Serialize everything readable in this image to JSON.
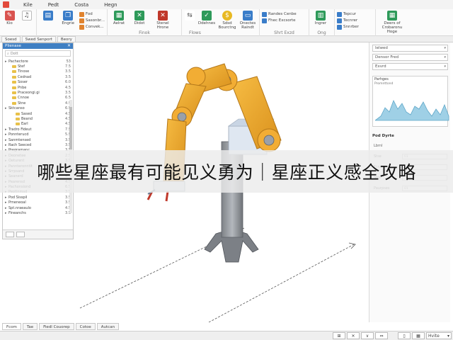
{
  "menu": {
    "items": [
      "Kile",
      "Pedt",
      "Costa",
      "Hegn"
    ]
  },
  "ribbon": {
    "groups": [
      {
        "label": "",
        "buttons": [
          {
            "label": "Kio",
            "icon": "pencil-icon",
            "color": "#d9534f"
          },
          {
            "label": "",
            "icon": "bell-icon",
            "color": "#555555"
          }
        ]
      },
      {
        "label": "",
        "buttons": [
          {
            "label": "",
            "icon": "document-icon",
            "color": "#3a7dc9"
          },
          {
            "label": "Engrie",
            "icon": "copy-icon",
            "color": "#3a7dc9"
          }
        ],
        "small": [
          {
            "label": "Fod",
            "color": "#e0832f"
          },
          {
            "label": "Sasonbr...",
            "color": "#e0832f"
          },
          {
            "label": "Convek...",
            "color": "#e0832f"
          }
        ]
      },
      {
        "label": "Finok",
        "buttons": [
          {
            "label": "Aelrat",
            "icon": "grid-icon",
            "color": "#2e9a5a"
          },
          {
            "label": "Didot",
            "icon": "cross-icon",
            "color": "#2e9a5a"
          },
          {
            "label": "Stenel\nHrone",
            "icon": "delete-icon",
            "color": "#c0392b"
          }
        ]
      },
      {
        "label": "Flows",
        "buttons": [
          {
            "label": "",
            "icon": "arrows-icon",
            "color": "#555555"
          },
          {
            "label": "Ddehnes",
            "icon": "check-icon",
            "color": "#2e9a5a"
          },
          {
            "label": "Sdsd\nBourctng",
            "icon": "coin-icon",
            "color": "#e8b923"
          },
          {
            "label": "Onectes\nRaindt",
            "icon": "folder-icon",
            "color": "#3a7dc9"
          }
        ]
      },
      {
        "label": "Shrt Exzd",
        "small": [
          {
            "label": "Randes Cenbe",
            "color": "#3a7dc9"
          },
          {
            "label": "Fhec Excsorte",
            "color": "#3a7dc9"
          },
          {
            "label": "Shrt Exzd",
            "color": "#3a7dc9"
          }
        ]
      },
      {
        "label": "Ong",
        "buttons": [
          {
            "label": "Ingrer",
            "icon": "chart-icon",
            "color": "#2e9a5a"
          }
        ]
      },
      {
        "label": "",
        "small": [
          {
            "label": "Tepcur",
            "color": "#3a7dc9"
          },
          {
            "label": "Tecnrer",
            "color": "#3a7dc9"
          },
          {
            "label": "Snnrber",
            "color": "#3a7dc9"
          }
        ]
      },
      {
        "label": "",
        "buttons": [
          {
            "label": "Deers of\nCrobaronu\nHoge",
            "icon": "spreadsheet-icon",
            "color": "#2e9a5a"
          }
        ]
      }
    ]
  },
  "doc_tabs": [
    "Soesd",
    "Swed Senport",
    "Beory"
  ],
  "left_panel": {
    "title": "Plienase",
    "search_placeholder": "Dott",
    "tree": [
      {
        "name": "Pachectore",
        "val": "53",
        "indent": 0,
        "folder": false
      },
      {
        "name": "Stef",
        "val": "7.5",
        "indent": 1,
        "folder": true
      },
      {
        "name": "Tinose",
        "val": "3.5",
        "indent": 1,
        "folder": true
      },
      {
        "name": "Cednad",
        "val": "3.5",
        "indent": 1,
        "folder": true
      },
      {
        "name": "Soser",
        "val": "6.0",
        "indent": 1,
        "folder": true
      },
      {
        "name": "Pnbe",
        "val": "4.5",
        "indent": 1,
        "folder": true
      },
      {
        "name": "Praceongi.gi",
        "val": "3.5",
        "indent": 1,
        "folder": true
      },
      {
        "name": "Cnnoe",
        "val": "6.5",
        "indent": 1,
        "folder": true
      },
      {
        "name": "Stne",
        "val": "4.9",
        "indent": 1,
        "folder": true
      },
      {
        "name": "Sktcanso",
        "val": "6.5",
        "indent": 0,
        "folder": false
      },
      {
        "name": "Sased",
        "val": "4.5",
        "indent": 2,
        "folder": true
      },
      {
        "name": "Beand",
        "val": "4.5",
        "indent": 2,
        "folder": true
      },
      {
        "name": "Earl",
        "val": "4.5",
        "indent": 2,
        "folder": true
      },
      {
        "name": "Tradro Fideut",
        "val": "7.5",
        "indent": 0,
        "folder": false
      },
      {
        "name": "Ponnterucd",
        "val": "5.9",
        "indent": 0,
        "folder": false
      },
      {
        "name": "Sanmtensed",
        "val": "3.5",
        "indent": 0,
        "folder": false
      },
      {
        "name": "Rach Seeced",
        "val": "3.5",
        "indent": 0,
        "folder": false
      },
      {
        "name": "Pregramanc",
        "val": "3.5",
        "indent": 0,
        "folder": false
      },
      {
        "name": "Deonetee",
        "val": "2.5",
        "indent": 0,
        "folder": false
      },
      {
        "name": "Oeturent",
        "val": "3.5",
        "indent": 0,
        "folder": false
      },
      {
        "name": "Pannteronntit",
        "val": "4.5",
        "indent": 0,
        "folder": false
      },
      {
        "name": "Srrpsand",
        "val": "3.5",
        "indent": 0,
        "folder": false
      },
      {
        "name": "Seanerd",
        "val": "4.5",
        "indent": 0,
        "folder": false
      },
      {
        "name": "Pearensd",
        "val": "4.5",
        "indent": 0,
        "folder": false
      },
      {
        "name": "Pachonsiond",
        "val": "6.5",
        "indent": 0,
        "folder": false
      },
      {
        "name": "Peoltnmsd",
        "val": "3.5",
        "indent": 0,
        "folder": false
      },
      {
        "name": "Pod Sisspil",
        "val": "3.5",
        "indent": 0,
        "folder": false
      },
      {
        "name": "Pmeneoal",
        "val": "3.5",
        "indent": 0,
        "folder": false
      },
      {
        "name": "Spt.nraeaulo",
        "val": "4.5",
        "indent": 0,
        "folder": false
      },
      {
        "name": "Fineanchs",
        "val": "3.5",
        "indent": 0,
        "folder": false
      }
    ]
  },
  "right_panel": {
    "dropdowns": [
      "Ielwed",
      "Densor Fred",
      "Exvrd"
    ],
    "chart_title": "Parhges",
    "chart_subtitle": "Promnttond",
    "section_title": "Pod Dyrte",
    "sub_label": "Lbrnl",
    "rows": [
      {
        "key": "Stse",
        "value": "01"
      },
      {
        "key": "Fcnd",
        "value": ""
      },
      {
        "key": "Stre",
        "value": ""
      },
      {
        "key": "Paurpses",
        "value": "01"
      }
    ]
  },
  "bottom_tabs": [
    "Fcom",
    "Tae",
    "Fiedl Couorep",
    "Cotoe",
    "Autcan"
  ],
  "status": {
    "right_label": "Hvite"
  },
  "overlay_text": "哪些星座最有可能见义勇为｜星座正义感全攻略",
  "colors": {
    "arm_orange": "#f0a82c",
    "arm_shadow": "#c98a1a",
    "joint_grey": "#9aa0a8",
    "pedestal": "#8a8e94",
    "chart_fill": "#9fd0e6",
    "accent_blue": "#3f7fc3"
  }
}
